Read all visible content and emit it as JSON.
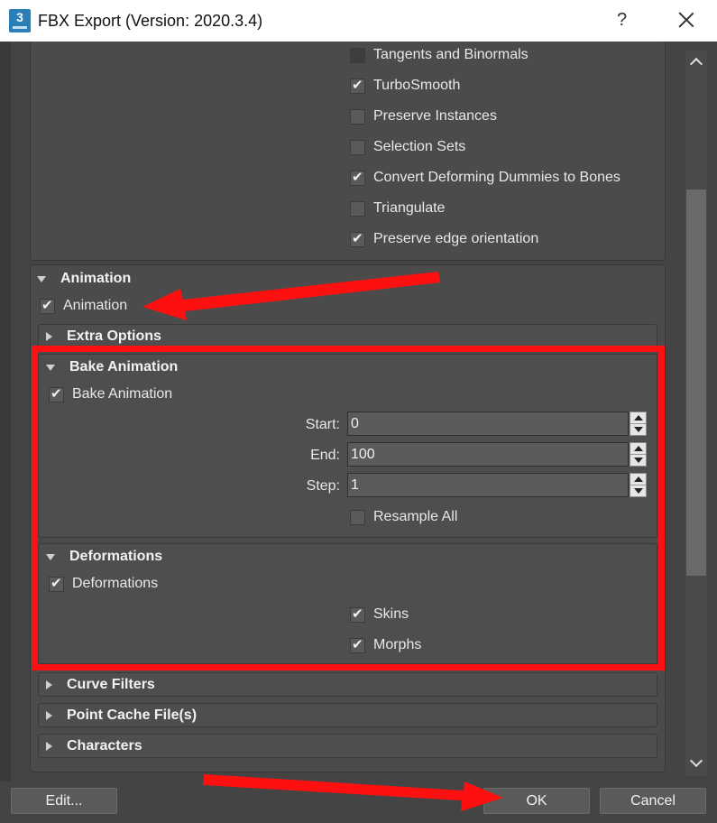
{
  "window": {
    "title": "FBX Export (Version: 2020.3.4)",
    "app_icon_text": "3",
    "help_label": "?"
  },
  "geometry_options": [
    {
      "label": "Tangents and Binormals",
      "checked": false,
      "dim": true
    },
    {
      "label": "TurboSmooth",
      "checked": true
    },
    {
      "label": "Preserve Instances",
      "checked": false
    },
    {
      "label": "Selection Sets",
      "checked": false
    },
    {
      "label": "Convert Deforming Dummies to Bones",
      "checked": true
    },
    {
      "label": "Triangulate",
      "checked": false
    },
    {
      "label": "Preserve edge orientation",
      "checked": true
    }
  ],
  "animation": {
    "section_title": "Animation",
    "checkbox_label": "Animation",
    "checked": true,
    "extra_options_title": "Extra Options",
    "bake": {
      "section_title": "Bake Animation",
      "checkbox_label": "Bake Animation",
      "checked": true,
      "start_label": "Start:",
      "start_value": "0",
      "end_label": "End:",
      "end_value": "100",
      "step_label": "Step:",
      "step_value": "1",
      "resample_label": "Resample All",
      "resample_checked": false
    },
    "deformations": {
      "section_title": "Deformations",
      "checkbox_label": "Deformations",
      "checked": true,
      "skins_label": "Skins",
      "skins_checked": true,
      "morphs_label": "Morphs",
      "morphs_checked": true
    },
    "curve_filters_title": "Curve Filters",
    "point_cache_title": "Point Cache File(s)",
    "characters_title": "Characters"
  },
  "buttons": {
    "edit": "Edit...",
    "ok": "OK",
    "cancel": "Cancel"
  },
  "annotation_color": "#ff1010"
}
